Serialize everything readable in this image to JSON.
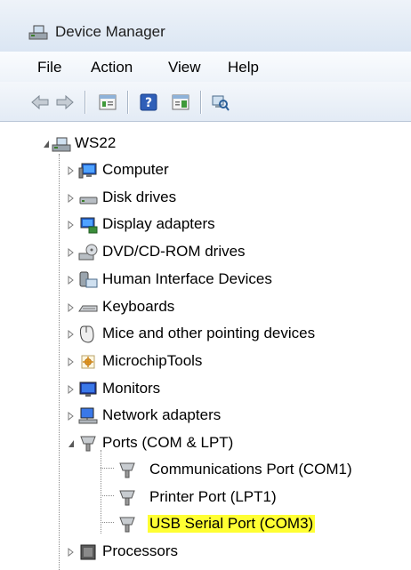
{
  "window": {
    "title": "Device Manager"
  },
  "menu": {
    "items": [
      "File",
      "Action",
      "View",
      "Help"
    ]
  },
  "toolbar": {
    "icons": [
      "back-arrow-icon",
      "forward-arrow-icon",
      "properties-icon",
      "help-icon",
      "details-pane-icon",
      "scan-hardware-icon"
    ]
  },
  "tree": {
    "root": "WS22",
    "nodes": [
      "Computer",
      "Disk drives",
      "Display adapters",
      "DVD/CD-ROM drives",
      "Human Interface Devices",
      "Keyboards",
      "Mice and other pointing devices",
      "MicrochipTools",
      "Monitors",
      "Network adapters",
      "Ports (COM & LPT)",
      "Processors"
    ],
    "ports_children": [
      "Communications Port (COM1)",
      "Printer Port (LPT1)",
      "USB Serial Port (COM3)"
    ]
  },
  "colors": {
    "highlight": "#ffff33",
    "titlebar": "#dbe6f3"
  }
}
